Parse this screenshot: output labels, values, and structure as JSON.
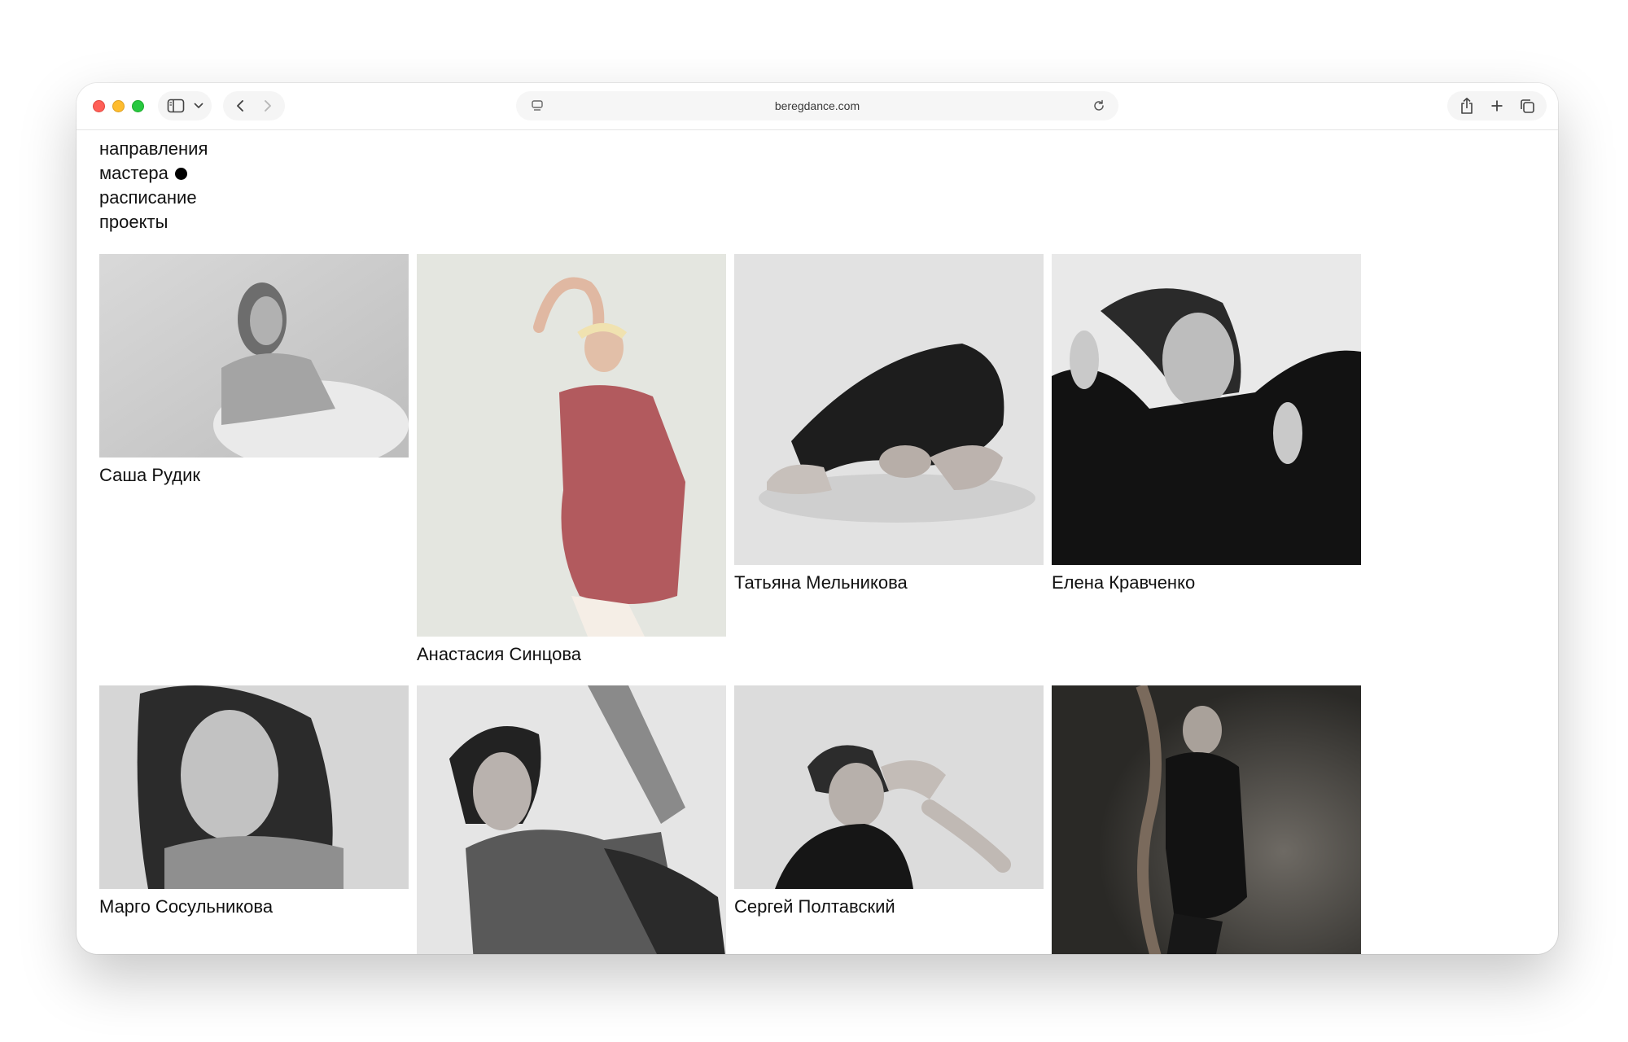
{
  "browser": {
    "url": "beregdance.com"
  },
  "nav": {
    "items": [
      {
        "label": "направления"
      },
      {
        "label": "мастера"
      },
      {
        "label": "расписание"
      },
      {
        "label": "проекты"
      }
    ],
    "active_index": 1
  },
  "masters": [
    {
      "name": "Саша Рудик"
    },
    {
      "name": "Анастасия Синцова"
    },
    {
      "name": "Татьяна Мельникова"
    },
    {
      "name": "Елена Кравченко"
    },
    {
      "name": "Марго Сосульникова"
    },
    {
      "name": ""
    },
    {
      "name": "Сергей Полтавский"
    },
    {
      "name": ""
    }
  ],
  "colors": {
    "accent_red": "#ff5f57",
    "accent_yellow": "#febc2e",
    "accent_green": "#28c840"
  }
}
